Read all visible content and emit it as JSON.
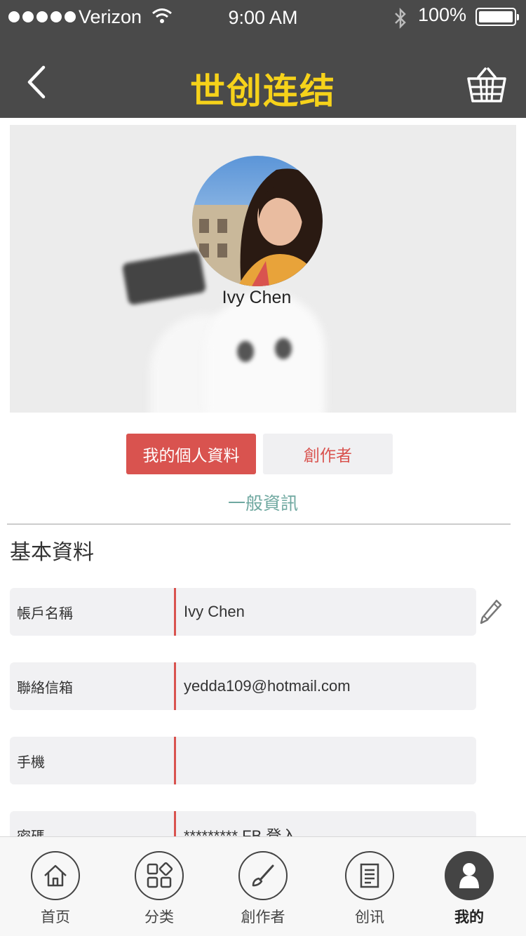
{
  "status_bar": {
    "carrier": "Verizon",
    "time": "9:00 AM",
    "battery": "100%"
  },
  "header": {
    "title": "世创连结"
  },
  "profile": {
    "name": "Ivy Chen"
  },
  "tabs": [
    {
      "label": "我的個人資料",
      "active": true
    },
    {
      "label": "創作者",
      "active": false
    }
  ],
  "section_link": "一般資訊",
  "section_title": "基本資料",
  "fields": [
    {
      "label": "帳戶名稱",
      "value": "Ivy Chen"
    },
    {
      "label": "聯絡信箱",
      "value": "yedda109@hotmail.com"
    },
    {
      "label": "手機",
      "value": ""
    },
    {
      "label": "密碼",
      "value": "********* FB 登入"
    }
  ],
  "tab_bar": [
    {
      "label": "首页",
      "icon": "home-icon"
    },
    {
      "label": "分类",
      "icon": "category-icon"
    },
    {
      "label": "創作者",
      "icon": "brush-icon"
    },
    {
      "label": "创讯",
      "icon": "news-icon"
    },
    {
      "label": "我的",
      "icon": "profile-icon",
      "active": true
    }
  ],
  "colors": {
    "header_bg": "#4a4a4a",
    "logo": "#f6d21a",
    "accent": "#d9534f",
    "link": "#6fa8a0"
  }
}
